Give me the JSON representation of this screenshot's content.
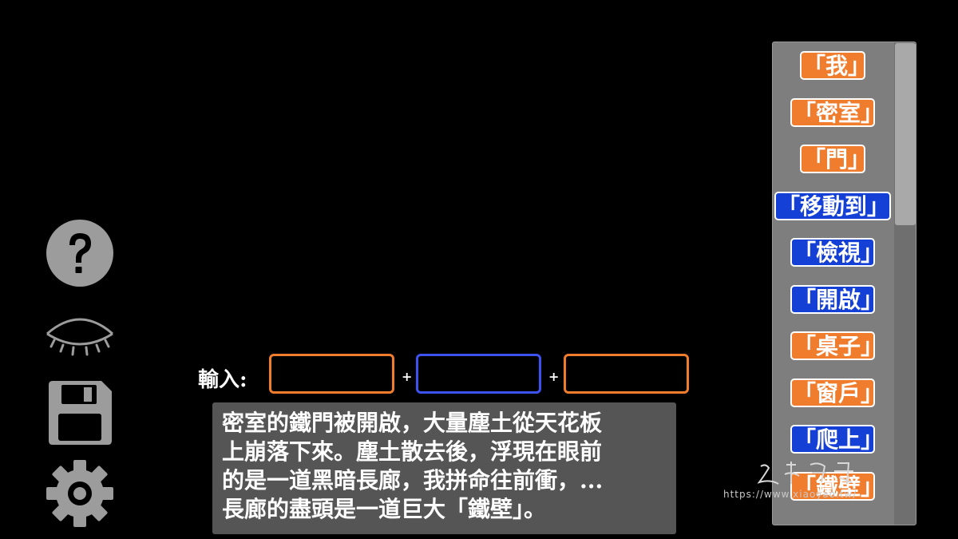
{
  "sidebar": {
    "icons": [
      "help-icon",
      "eye-closed-icon",
      "save-icon",
      "settings-gear-icon"
    ]
  },
  "input_bar": {
    "label": "輸入:",
    "plus1": "+",
    "plus2": "+",
    "slots": [
      {
        "value": "",
        "type": "noun",
        "color": "#f07c2d"
      },
      {
        "value": "",
        "type": "verb",
        "color": "#3e52f0"
      },
      {
        "value": "",
        "type": "noun",
        "color": "#f07c2d"
      }
    ]
  },
  "narration": {
    "text": "密室的鐵門被開啟，大量塵土從天花板\n上崩落下來。塵土散去後，浮現在眼前\n的是一道黑暗長廊，我拼命往前衝，...\n長廊的盡頭是一道巨大「鐵壁」。"
  },
  "word_panel": {
    "words": [
      {
        "label": "「我」",
        "type": "noun"
      },
      {
        "label": "「密室」",
        "type": "noun"
      },
      {
        "label": "「門」",
        "type": "noun"
      },
      {
        "label": "「移動到」",
        "type": "verb"
      },
      {
        "label": "「檢視」",
        "type": "verb"
      },
      {
        "label": "「開啟」",
        "type": "verb"
      },
      {
        "label": "「桌子」",
        "type": "noun"
      },
      {
        "label": "「窗戶」",
        "type": "noun"
      },
      {
        "label": "「爬上」",
        "type": "verb"
      },
      {
        "label": "「鐵壁」",
        "type": "noun"
      }
    ],
    "scroll_position": 0
  },
  "watermark": {
    "url": "https://www.xiaoyao.tw/",
    "logo_text": "逍遙窩"
  },
  "colors": {
    "noun": "#f07c2d",
    "verb": "#1540d6",
    "panel": "#7e7e7e",
    "textbox": "#555555"
  }
}
